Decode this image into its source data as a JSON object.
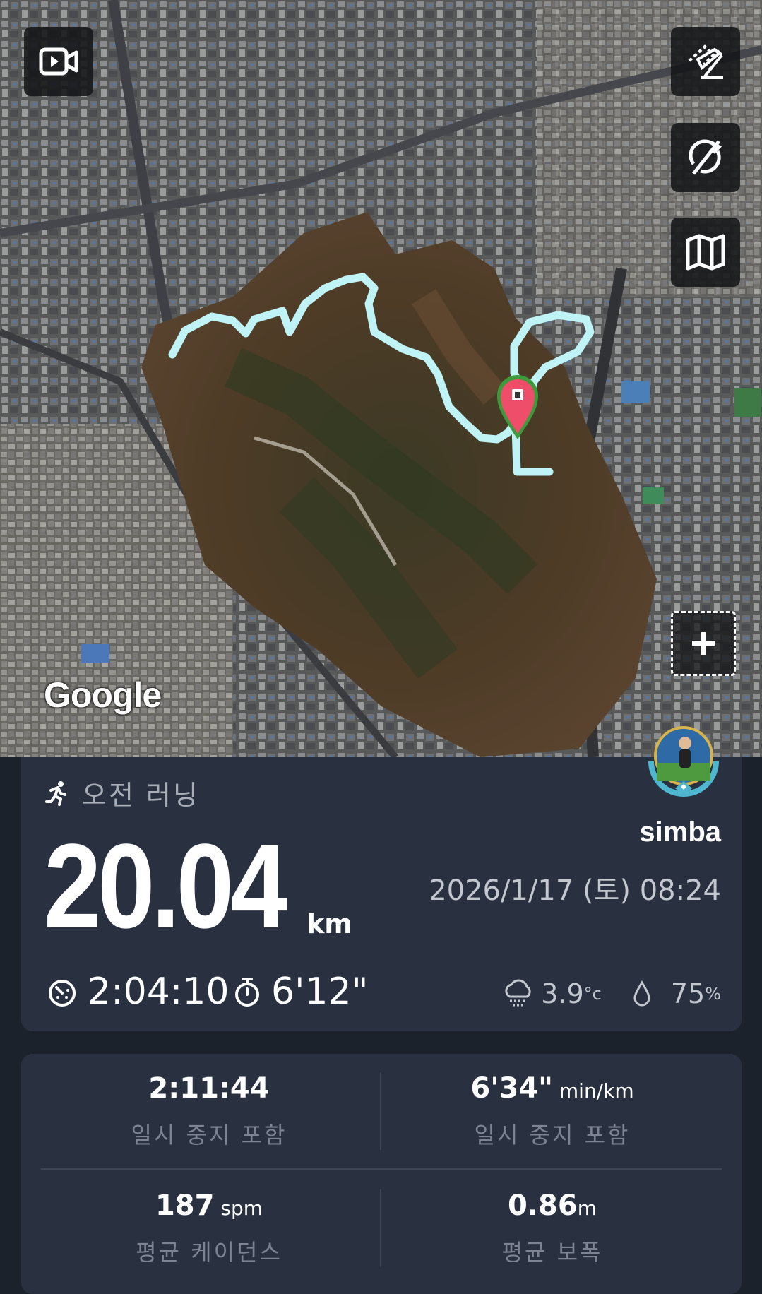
{
  "map": {
    "attribution": "Google",
    "buttons": [
      "video-icon",
      "draw-route-icon",
      "rotate-off-icon",
      "map-icon"
    ],
    "route_color": "#bff3f5",
    "marker_color": "#ef4e6a"
  },
  "activity": {
    "type_label": "오전 러닝",
    "user": "simba",
    "distance": "20.04",
    "distance_unit": "km",
    "datetime": "2026/1/17 (토) 08:24",
    "duration": "2:04:10",
    "pace": "6'12\"",
    "temperature": "3.9",
    "temperature_unit": "°c",
    "humidity": "75",
    "humidity_unit": "%"
  },
  "stats": [
    {
      "value": "2:11:44",
      "unit": "",
      "label": "일시 중지 포함"
    },
    {
      "value": "6'34\"",
      "unit": " min/km",
      "label": "일시 중지 포함"
    },
    {
      "value": "187",
      "unit": " spm",
      "label": "평균 케이던스"
    },
    {
      "value": "0.86",
      "unit": "m",
      "label": "평균 보폭"
    }
  ]
}
